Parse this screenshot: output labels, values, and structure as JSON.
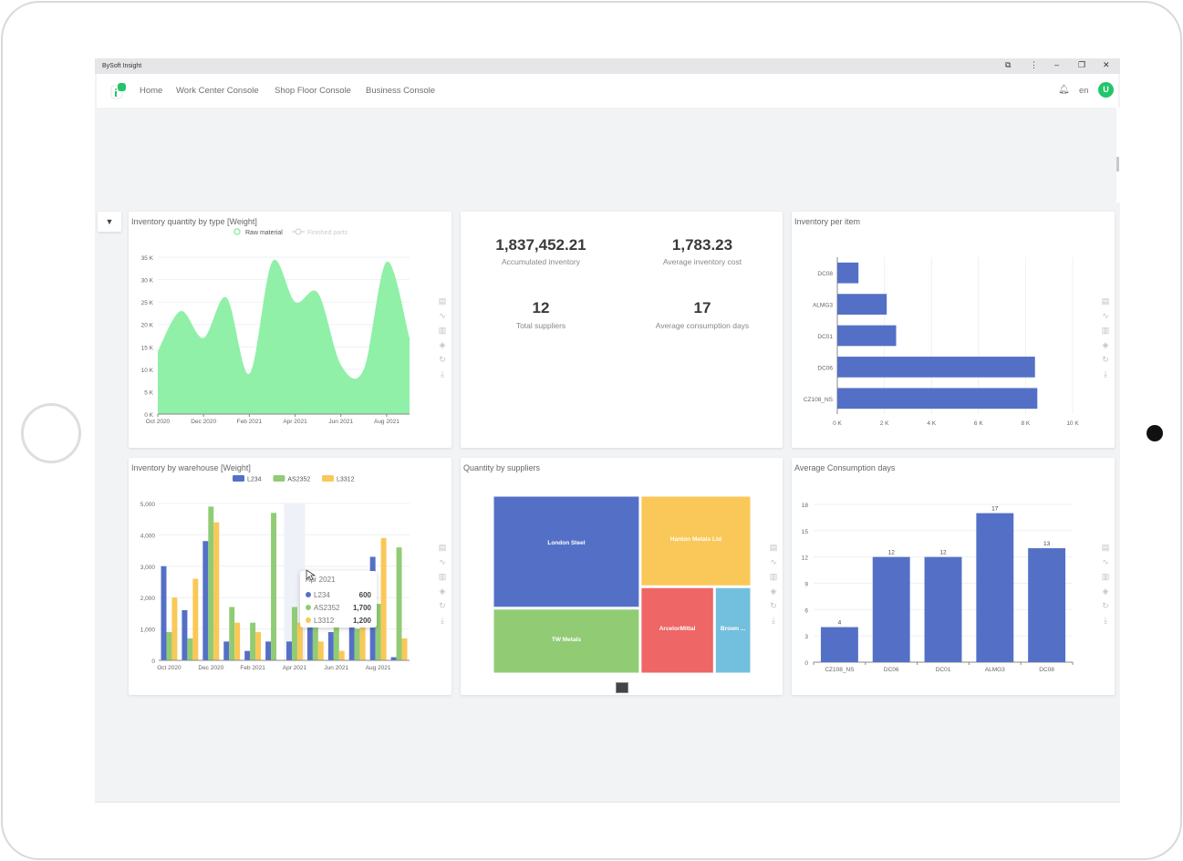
{
  "window": {
    "title": "BySoft Insight",
    "controls": [
      "translate-icon",
      "more-icon",
      "minimize-icon",
      "restore-icon",
      "close-icon"
    ]
  },
  "navbar": {
    "items": [
      {
        "label": "Home"
      },
      {
        "label": "Work Center Console"
      },
      {
        "label": "Shop Floor Console"
      },
      {
        "label": "Business Console"
      }
    ],
    "language": "en",
    "avatar_initial": "U",
    "accent_color": "#22c66a"
  },
  "filter_button": {
    "icon": "filter-icon"
  },
  "toolbox_icons": [
    "data-view-icon",
    "line-chart-icon",
    "bar-chart-icon",
    "stack-icon",
    "restore-icon",
    "download-icon"
  ],
  "kpis": [
    {
      "value": "1,837,452.21",
      "label": "Accumulated inventory"
    },
    {
      "value": "1,783.23",
      "label": "Average inventory cost"
    },
    {
      "value": "12",
      "label": "Total suppliers"
    },
    {
      "value": "17",
      "label": "Average consumption days"
    }
  ],
  "tooltip": {
    "title": "Apr 2021",
    "rows": [
      {
        "name": "L234",
        "value": "600",
        "color": "#5470c6"
      },
      {
        "name": "AS2352",
        "value": "1,700",
        "color": "#91cc75"
      },
      {
        "name": "L3312",
        "value": "1,200",
        "color": "#fac858"
      }
    ]
  },
  "chart_data": [
    {
      "id": "inventory-by-type",
      "type": "area",
      "title": "Inventory quantity by type [Weight]",
      "legend": [
        {
          "name": "Raw material",
          "active": true,
          "color": "#90f0a8"
        },
        {
          "name": "Finished parts",
          "active": false,
          "color": "#cccccc"
        }
      ],
      "legend_position": "top-center",
      "x_ticks": [
        "Oct 2020",
        "Dec 2020",
        "Feb 2021",
        "Apr 2021",
        "Jun 2021",
        "Aug 2021"
      ],
      "x": [
        "Oct 2020",
        "Nov 2020",
        "Dec 2020",
        "Jan 2021",
        "Feb 2021",
        "Mar 2021",
        "Apr 2021",
        "May 2021",
        "Jun 2021",
        "Jul 2021",
        "Aug 2021",
        "Sep 2021"
      ],
      "series": [
        {
          "name": "Raw material",
          "values": [
            14000,
            23000,
            17000,
            26000,
            9000,
            34000,
            25000,
            27000,
            11000,
            10000,
            34000,
            17000
          ]
        }
      ],
      "y_ticks": [
        "0 K",
        "5 K",
        "10 K",
        "15 K",
        "20 K",
        "25 K",
        "30 K",
        "35 K"
      ],
      "ylim": [
        0,
        35000
      ],
      "grid": true
    },
    {
      "id": "inventory-per-item",
      "type": "bar",
      "orientation": "horizontal",
      "title": "Inventory per item",
      "categories": [
        "DC08",
        "ALMG3",
        "DC01",
        "DC06",
        "CZ108_NS"
      ],
      "values": [
        900,
        2100,
        2500,
        8400,
        8500
      ],
      "x_ticks": [
        "0 K",
        "2 K",
        "4 K",
        "6 K",
        "8 K",
        "10 K"
      ],
      "xlim": [
        0,
        10000
      ],
      "color": "#5470c6",
      "grid": true
    },
    {
      "id": "inventory-by-warehouse",
      "type": "bar",
      "title": "Inventory by warehouse [Weight]",
      "legend_position": "top-center",
      "categories": [
        "Oct 2020",
        "Nov 2020",
        "Dec 2020",
        "Jan 2021",
        "Feb 2021",
        "Mar 2021",
        "Apr 2021",
        "May 2021",
        "Jun 2021",
        "Jul 2021",
        "Aug 2021",
        "Sep 2021"
      ],
      "x_ticks": [
        "Oct 2020",
        "Dec 2020",
        "Feb 2021",
        "Apr 2021",
        "Jun 2021",
        "Aug 2021"
      ],
      "series": [
        {
          "name": "L234",
          "color": "#5470c6",
          "values": [
            3000,
            1600,
            3800,
            600,
            300,
            600,
            600,
            1300,
            900,
            1400,
            3300,
            100
          ]
        },
        {
          "name": "AS2352",
          "color": "#91cc75",
          "values": [
            900,
            700,
            4900,
            1700,
            1200,
            4700,
            1700,
            1500,
            1300,
            1000,
            1800,
            3600
          ]
        },
        {
          "name": "L3312",
          "color": "#fac858",
          "values": [
            2000,
            2600,
            4400,
            1200,
            900,
            0,
            1200,
            600,
            300,
            1300,
            3900,
            700
          ]
        }
      ],
      "highlighted_category": "Apr 2021",
      "y_ticks": [
        "0",
        "1,000",
        "2,000",
        "3,000",
        "4,000",
        "5,000"
      ],
      "ylim": [
        0,
        5000
      ],
      "grid": true
    },
    {
      "id": "quantity-by-suppliers",
      "type": "treemap",
      "title": "Quantity by suppliers",
      "items": [
        {
          "name": "London Steel",
          "value": 36,
          "color": "#5470c6"
        },
        {
          "name": "TW Metals",
          "value": 21,
          "color": "#91cc75"
        },
        {
          "name": "Hanton Metals Ltd",
          "value": 22,
          "color": "#fac858"
        },
        {
          "name": "ArcelorMittal",
          "value": 14,
          "color": "#ee6666"
        },
        {
          "name": "Brown ...",
          "value": 7,
          "color": "#73c0de"
        }
      ]
    },
    {
      "id": "average-consumption-days",
      "type": "bar",
      "title": "Average Consumption days",
      "categories": [
        "CZ108_NS",
        "DC06",
        "DC01",
        "ALMG3",
        "DC08"
      ],
      "values": [
        4,
        12,
        12,
        17,
        13
      ],
      "data_labels": [
        "4",
        "12",
        "12",
        "17",
        "13"
      ],
      "y_ticks": [
        "0",
        "3",
        "6",
        "9",
        "12",
        "15",
        "18"
      ],
      "ylim": [
        0,
        18
      ],
      "color": "#5470c6",
      "grid": true
    }
  ]
}
